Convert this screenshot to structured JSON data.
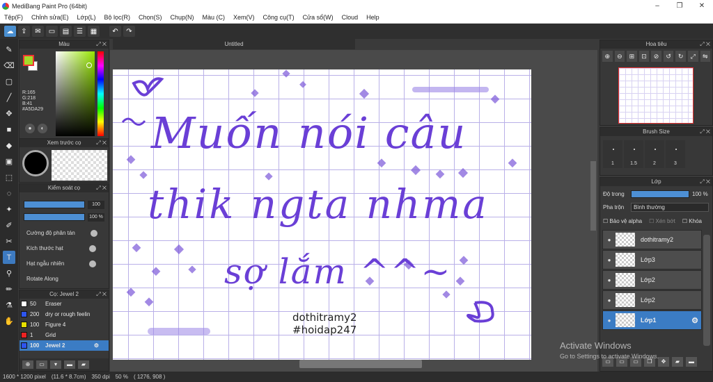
{
  "window": {
    "title": "MediBang Paint Pro (64bit)",
    "minimize": "–",
    "maximize": "❐",
    "close": "✕"
  },
  "menu": [
    "Tệp(F)",
    "Chỉnh sửa(E)",
    "Lớp(L)",
    "Bộ lọc(R)",
    "Chọn(S)",
    "Chụp(N)",
    "Màu (C)",
    "Xem(V)",
    "Công cụ(T)",
    "Cửa sổ(W)",
    "Cloud",
    "Help"
  ],
  "canvas": {
    "tab_title": "Untitled",
    "art_line1": "Muốn nói câu",
    "art_line2": "thik ngta nhma",
    "art_line3": "sợ lắm ^^~",
    "signature1": "dothitramy2",
    "signature2": "#hoidap247"
  },
  "colors": {
    "accent": "#4a8fd0",
    "foreground": "#A5DA29",
    "grid": "#b9b0e8",
    "ink": "#6a3fd6"
  },
  "color_panel": {
    "title": "Màu",
    "r": "R:165",
    "g": "G:218",
    "b": "B:41",
    "hex": "#A5DA29"
  },
  "brush_preview": {
    "title": "Xem trước cọ"
  },
  "brush_control": {
    "title": "Kiểm soát cọ",
    "size_value": "100",
    "opacity_value": "100 %",
    "rows": [
      "Cường độ phân tán",
      "Kích thước hạt",
      "Hạt ngẫu nhiên",
      "Rotate Along"
    ]
  },
  "brush_list": {
    "title": "Cọ: Jewel 2",
    "items": [
      {
        "size": "50",
        "name": "Eraser",
        "color": "#ffffff"
      },
      {
        "size": "200",
        "name": "dry or rough feelin",
        "color": "#2e55ee"
      },
      {
        "size": "100",
        "name": "Figure 4",
        "color": "#e8e000"
      },
      {
        "size": "1",
        "name": "Grid",
        "color": "#ee2222"
      },
      {
        "size": "100",
        "name": "Jewel 2",
        "color": "#2e55ee"
      }
    ]
  },
  "navigator": {
    "title": "Hoa tiêu"
  },
  "brush_size": {
    "title": "Brush Size",
    "sizes": [
      "1",
      "1.5",
      "2",
      "3"
    ]
  },
  "layers": {
    "title": "Lớp",
    "opacity_label": "Độ trong",
    "opacity_value": "100 %",
    "blend_label": "Pha trộn",
    "blend_value": "Bình thường",
    "protect_alpha": "Bảo vệ alpha",
    "clipping": "Xén bớt",
    "lock": "Khóa",
    "items": [
      "dothitramy2",
      "Lớp3",
      "Lớp2",
      "Lớp2",
      "Lớp1"
    ]
  },
  "status": {
    "size": "1600 * 1200 pixel",
    "cm": "(11.6 * 8.7cm)",
    "dpi": "350 dpi",
    "zoom": "50 %",
    "coords": "( 1276, 908 )"
  },
  "watermark": {
    "line1": "Activate Windows",
    "line2": "Go to Settings to activate Windows."
  }
}
